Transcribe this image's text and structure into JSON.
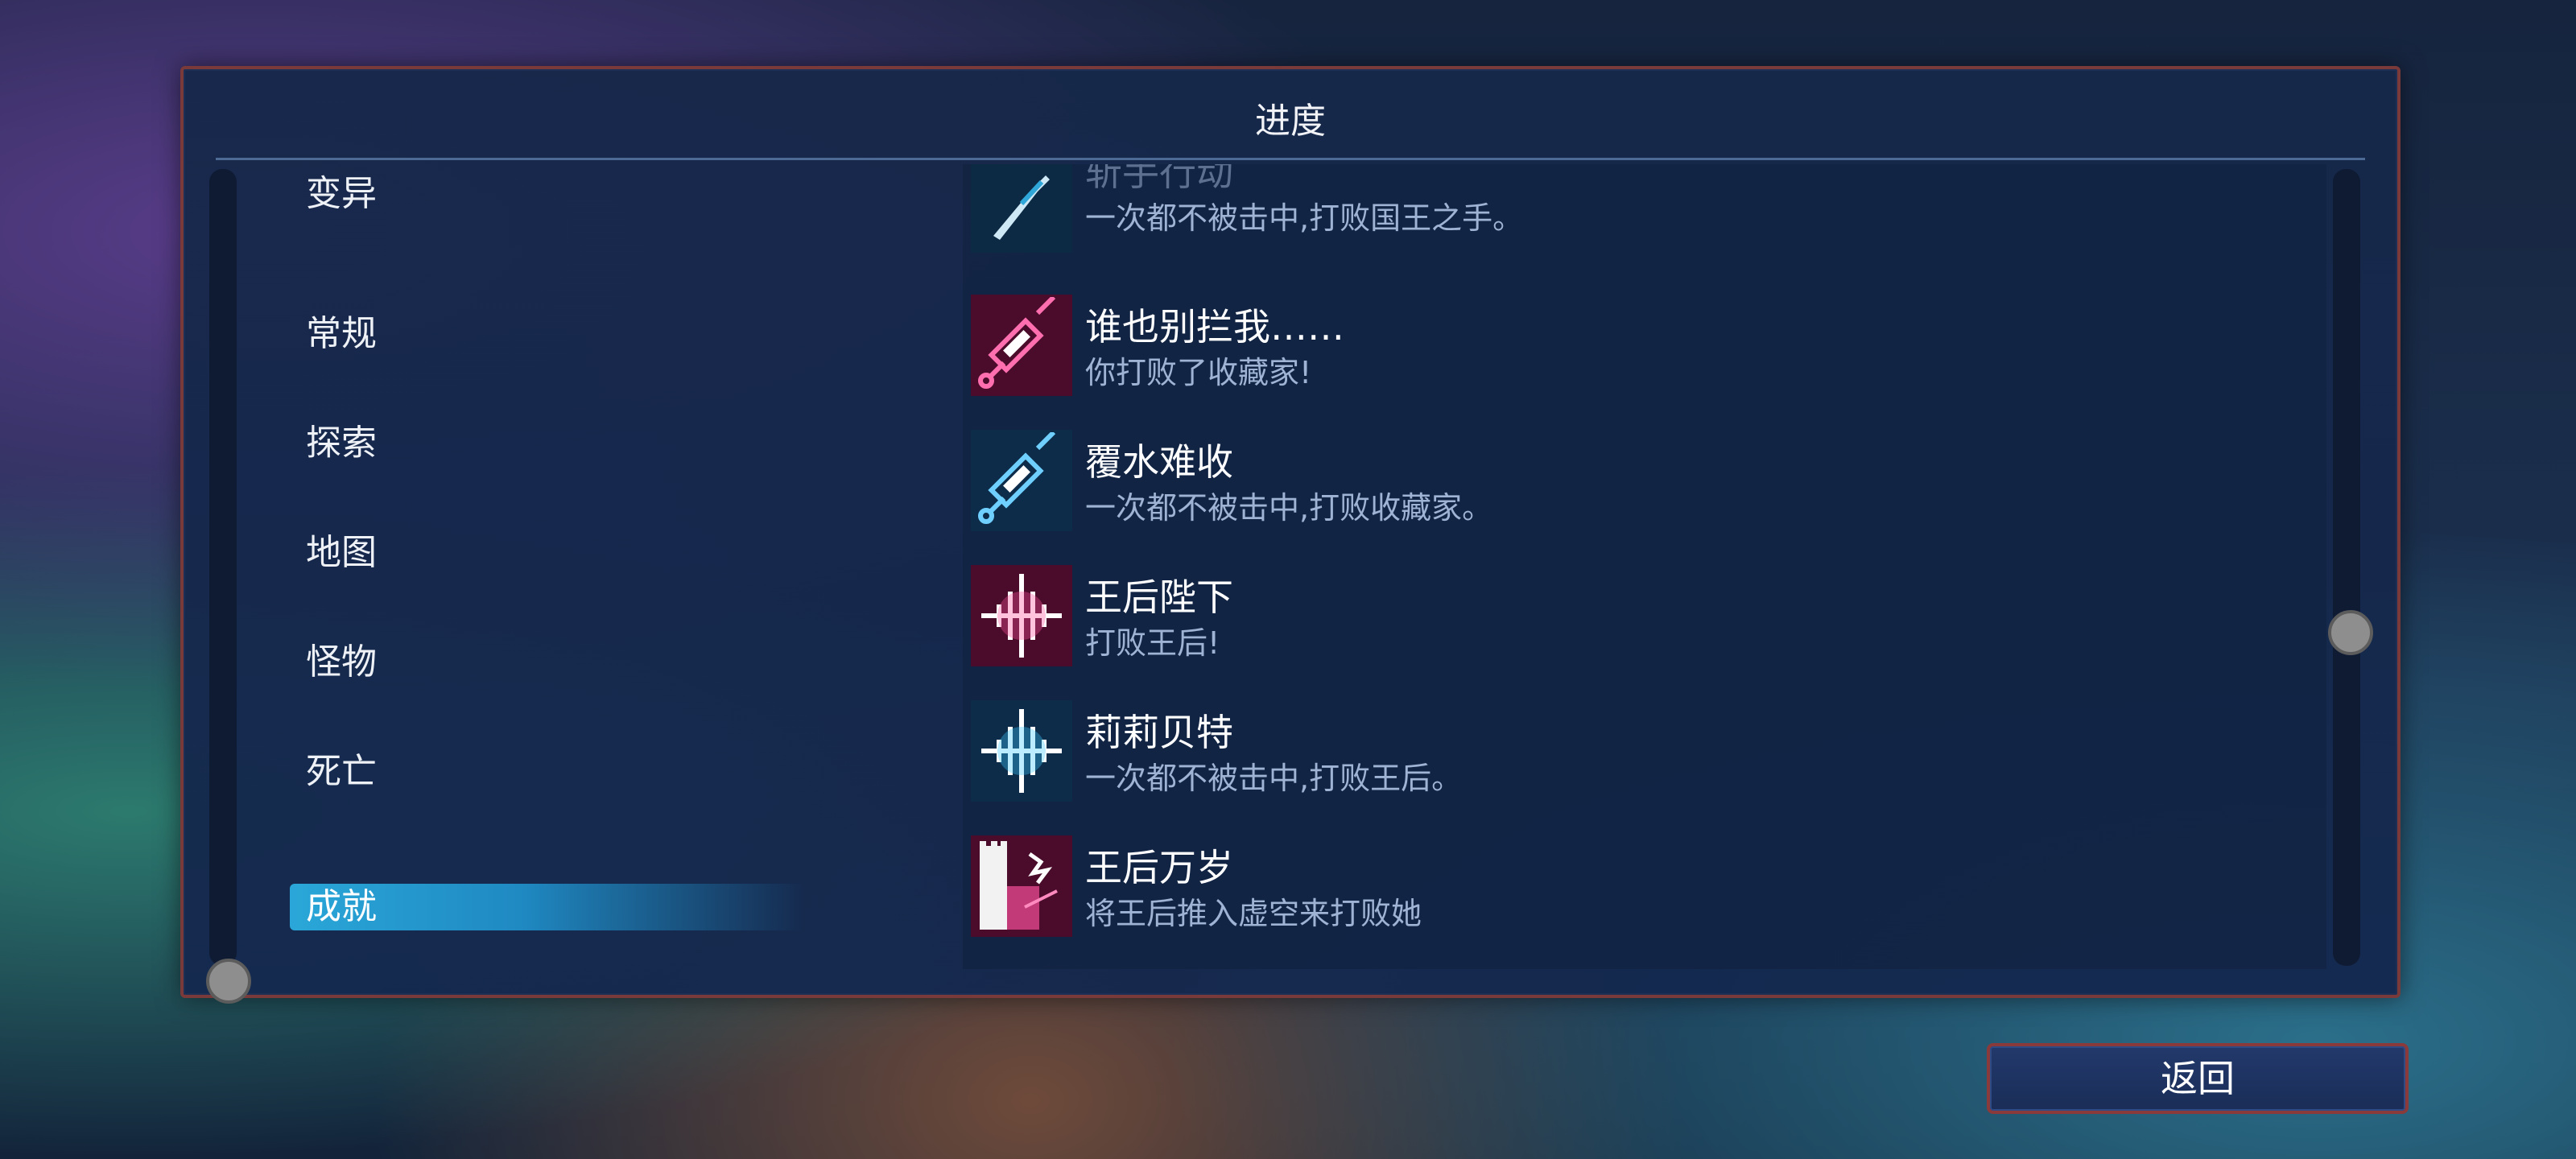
{
  "panel": {
    "title": "进度"
  },
  "categories": [
    {
      "label": "变异",
      "selected": false
    },
    {
      "label": "常规",
      "selected": false
    },
    {
      "label": "探索",
      "selected": false
    },
    {
      "label": "地图",
      "selected": false
    },
    {
      "label": "怪物",
      "selected": false
    },
    {
      "label": "死亡",
      "selected": false
    },
    {
      "label": "成就",
      "selected": true
    }
  ],
  "achievements": [
    {
      "name": "斩手行动",
      "desc": "一次都不被击中,打败国王之手。",
      "icon": "blade-icon",
      "color": "#2fa7d8"
    },
    {
      "name": "谁也别拦我……",
      "desc": "你打败了收藏家!",
      "icon": "syringe-icon",
      "color": "#e0257a"
    },
    {
      "name": "覆水难收",
      "desc": "一次都不被击中,打败收藏家。",
      "icon": "syringe-icon",
      "color": "#2fa7d8"
    },
    {
      "name": "王后陛下",
      "desc": "打败王后!",
      "icon": "soundwave-icon",
      "color": "#e0257a"
    },
    {
      "name": "莉莉贝特",
      "desc": "一次都不被击中,打败王后。",
      "icon": "soundwave-icon",
      "color": "#2fb8e0"
    },
    {
      "name": "王后万岁",
      "desc": "将王后推入虚空来打败她",
      "icon": "tower-icon",
      "color": "#e0257a"
    }
  ],
  "footer": {
    "back_label": "返回"
  }
}
